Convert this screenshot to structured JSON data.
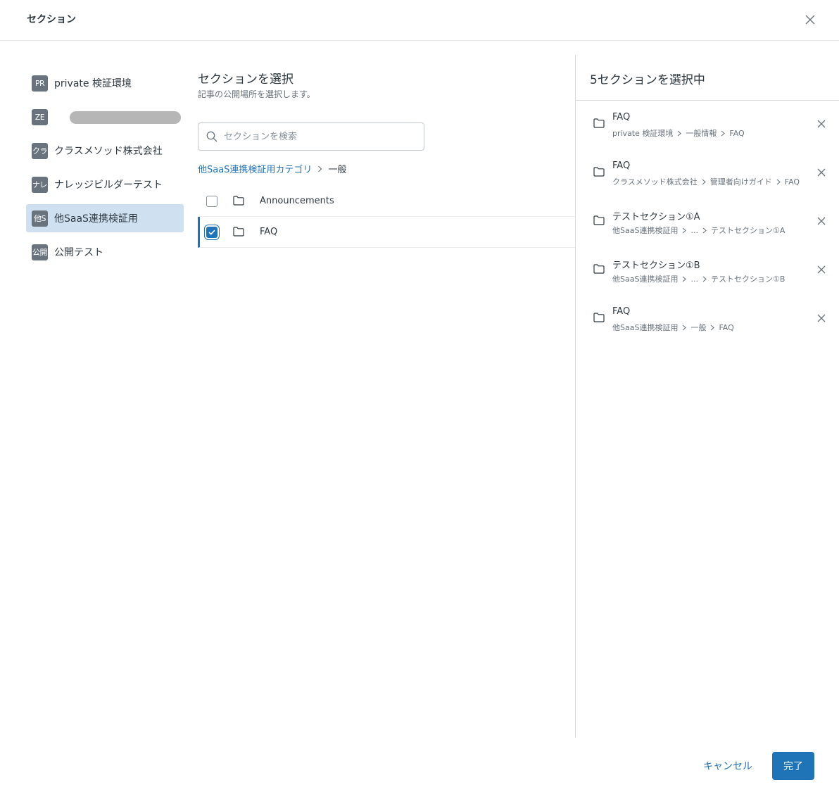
{
  "header": {
    "title": "セクション",
    "close_icon": "close-icon"
  },
  "brands": [
    {
      "badge": "PR",
      "label": "private 検証環境",
      "active": false,
      "redacted": false
    },
    {
      "badge": "ZE",
      "label": "",
      "active": false,
      "redacted": true
    },
    {
      "badge": "クラ",
      "label": "クラスメソッド株式会社",
      "active": false,
      "redacted": false
    },
    {
      "badge": "ナレ",
      "label": "ナレッジビルダーテスト",
      "active": false,
      "redacted": false
    },
    {
      "badge": "他S",
      "label": "他SaaS連携検証用",
      "active": true,
      "redacted": false
    },
    {
      "badge": "公開",
      "label": "公開テスト",
      "active": false,
      "redacted": false
    }
  ],
  "main": {
    "title": "セクションを選択",
    "subtitle": "記事の公開場所を選択します。",
    "search": {
      "placeholder": "セクションを検索",
      "value": ""
    },
    "breadcrumb": {
      "parent": "他SaaS連携検証用カテゴリ",
      "current": "一般"
    },
    "sections": [
      {
        "label": "Announcements",
        "checked": false
      },
      {
        "label": "FAQ",
        "checked": true
      }
    ]
  },
  "selected_panel": {
    "title": "5セクションを選択中",
    "items": [
      {
        "name": "FAQ",
        "path": [
          "private 検証環境",
          "一般情報",
          "FAQ"
        ]
      },
      {
        "name": "FAQ",
        "path": [
          "クラスメソッド株式会社",
          "管理者向けガイド",
          "FAQ"
        ]
      },
      {
        "name": "テストセクション①A",
        "path": [
          "他SaaS連携検証用",
          "...",
          "テストセクション①A"
        ]
      },
      {
        "name": "テストセクション①B",
        "path": [
          "他SaaS連携検証用",
          "...",
          "テストセクション①B"
        ]
      },
      {
        "name": "FAQ",
        "path": [
          "他SaaS連携検証用",
          "一般",
          "FAQ"
        ]
      }
    ]
  },
  "footer": {
    "cancel_label": "キャンセル",
    "done_label": "完了"
  },
  "colors": {
    "accent": "#1f73b7",
    "active_bg": "#cfe1f1",
    "badge_bg": "#68737d"
  }
}
